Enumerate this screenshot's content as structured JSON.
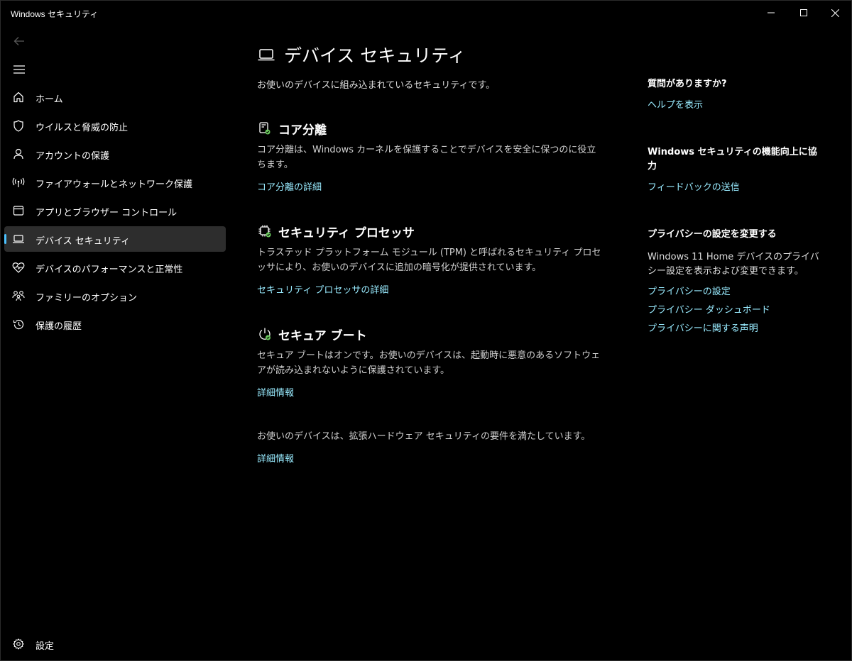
{
  "window": {
    "title": "Windows セキュリティ"
  },
  "sidebar": {
    "items": [
      {
        "label": "ホーム",
        "icon": "home-icon"
      },
      {
        "label": "ウイルスと脅威の防止",
        "icon": "shield-icon"
      },
      {
        "label": "アカウントの保護",
        "icon": "person-icon"
      },
      {
        "label": "ファイアウォールとネットワーク保護",
        "icon": "antenna-icon"
      },
      {
        "label": "アプリとブラウザー コントロール",
        "icon": "app-window-icon"
      },
      {
        "label": "デバイス セキュリティ",
        "icon": "laptop-icon",
        "active": true
      },
      {
        "label": "デバイスのパフォーマンスと正常性",
        "icon": "heart-pulse-icon"
      },
      {
        "label": "ファミリーのオプション",
        "icon": "family-icon"
      },
      {
        "label": "保護の履歴",
        "icon": "history-icon"
      }
    ],
    "settings_label": "設定"
  },
  "main": {
    "title": "デバイス セキュリティ",
    "description": "お使いのデバイスに組み込まれているセキュリティです。",
    "sections": {
      "core": {
        "title": "コア分離",
        "description": "コア分離は、Windows カーネルを保護することでデバイスを安全に保つのに役立ちます。",
        "link": "コア分離の詳細"
      },
      "processor": {
        "title": "セキュリティ プロセッサ",
        "description": "トラステッド プラットフォーム モジュール (TPM) と呼ばれるセキュリティ プロセッサにより、お使いのデバイスに追加の暗号化が提供されています。",
        "link": "セキュリティ プロセッサの詳細"
      },
      "boot": {
        "title": "セキュア ブート",
        "description": "セキュア ブートはオンです。お使いのデバイスは、起動時に悪意のあるソフトウェアが読み込まれないように保護されています。",
        "link": "詳細情報"
      },
      "hardware": {
        "description": "お使いのデバイスは、拡張ハードウェア セキュリティの要件を満たしています。",
        "link": "詳細情報"
      }
    }
  },
  "right": {
    "help": {
      "title": "質問がありますか?",
      "link": "ヘルプを表示"
    },
    "feedback": {
      "title": "Windows セキュリティの機能向上に協力",
      "link": "フィードバックの送信"
    },
    "privacy": {
      "title": "プライバシーの設定を変更する",
      "description": "Windows 11 Home デバイスのプライバシー設定を表示および変更できます。",
      "links": [
        "プライバシーの設定",
        "プライバシー ダッシュボード",
        "プライバシーに関する声明"
      ]
    }
  },
  "colors": {
    "accent": "#4cc2ff",
    "link": "#99ebff",
    "ok_green": "#6ccb5f"
  }
}
